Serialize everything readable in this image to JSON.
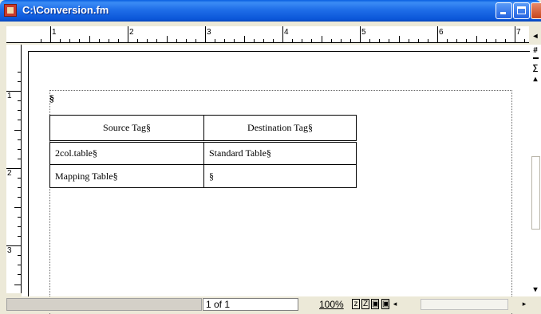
{
  "window": {
    "title": "C:\\Conversion.fm"
  },
  "ruler": {
    "horizontal_numbers": [
      "1",
      "2",
      "3",
      "4",
      "5",
      "6",
      "7"
    ],
    "vertical_numbers": [
      "1",
      "2",
      "3"
    ]
  },
  "document": {
    "paragraph_mark": "§",
    "table": {
      "headers": [
        "Source Tag§",
        "Destination   Tag§"
      ],
      "rows": [
        [
          "2col.table§",
          "Standard Table§"
        ],
        [
          "Mapping Table§",
          "§"
        ]
      ]
    }
  },
  "side_toolbar": {
    "symbols": [
      "#",
      "∑"
    ]
  },
  "status": {
    "page_indicator": "1 of 1",
    "zoom": "100%",
    "zoom_out_label": "z",
    "zoom_in_label": "Z"
  }
}
